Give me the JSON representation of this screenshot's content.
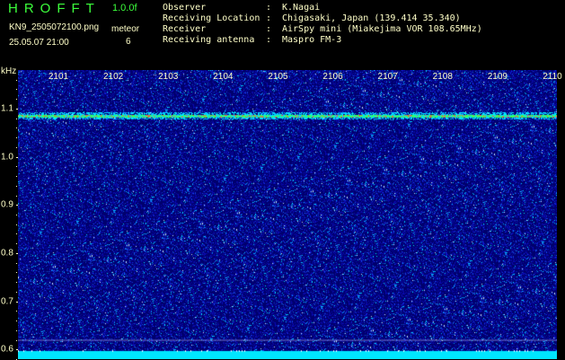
{
  "header": {
    "app_title": "HROFFT",
    "version": "1.0.0f",
    "filename": "KN9_2505072100.png",
    "datetime": "25.05.07 21:00",
    "counter_label": "meteor",
    "counter_value": "6",
    "info": [
      {
        "key": "Observer",
        "value": "K.Nagai"
      },
      {
        "key": "Receiving Location",
        "value": "Chigasaki, Japan (139.414 35.340)"
      },
      {
        "key": "Receiver",
        "value": "AirSpy mini (Miakejima VOR 108.65MHz)"
      },
      {
        "key": "Receiving antenna",
        "value": "Maspro FM-3"
      }
    ],
    "separator": ":"
  },
  "chart_data": {
    "type": "heatmap",
    "title": "",
    "xlabel": "",
    "ylabel": "kHz",
    "x_tick_labels": [
      "2101",
      "2102",
      "2103",
      "2104",
      "2105",
      "2106",
      "2107",
      "2108",
      "2109",
      "2110"
    ],
    "y_tick_labels": [
      1.1,
      1.0,
      0.9,
      0.8,
      0.7,
      0.6
    ],
    "ylim": [
      0.58,
      1.18
    ],
    "carrier_frequency_khz": 1.085,
    "meteor_count": 6,
    "colors": {
      "background": "#00006e",
      "noise_low": "#1414c8",
      "noise_high": "#00b4ff",
      "carrier": "#3cff3c",
      "carrier_peak": "#ff3c3c",
      "bottom_band": "#00e6ff"
    }
  }
}
